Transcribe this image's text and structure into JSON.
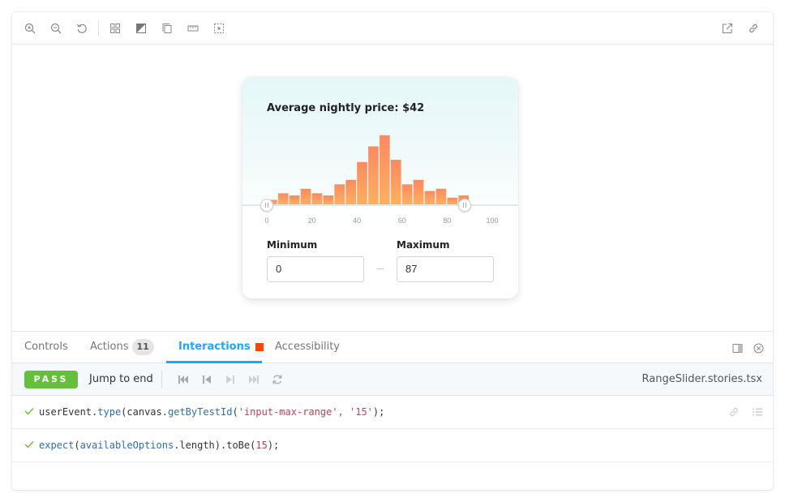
{
  "toolbar": {
    "left_icons": [
      "zoom-in-icon",
      "zoom-out-icon",
      "reset-zoom-icon",
      "grid-icon",
      "background-icon",
      "viewport-icon",
      "measure-icon",
      "outline-icon"
    ],
    "right_icons": [
      "open-new-tab-icon",
      "copy-link-icon"
    ]
  },
  "card": {
    "title": "Average nightly price: $42",
    "chart_data": {
      "type": "bar",
      "x": [
        0,
        5,
        10,
        15,
        20,
        25,
        30,
        35,
        40,
        45,
        50,
        55,
        60,
        65,
        70,
        75,
        80,
        85,
        90,
        95
      ],
      "values": [
        2,
        5,
        4,
        7,
        5,
        4,
        9,
        11,
        19,
        26,
        31,
        20,
        9,
        11,
        6,
        7
      ],
      "all_values": [
        2,
        5,
        4,
        7,
        5,
        4,
        9,
        11,
        19,
        26,
        31,
        20,
        9,
        11,
        6,
        7
      ],
      "ticks": [
        "0",
        "20",
        "40",
        "60",
        "80",
        "100"
      ],
      "selected_range": [
        0,
        87
      ],
      "colors": {
        "bar_top": "#fb8a63",
        "bar_bottom": "#ffb05e",
        "inactive": "#e2e2e2"
      }
    },
    "minimum_label": "Minimum",
    "maximum_label": "Maximum",
    "minimum_value": "0",
    "maximum_value": "87"
  },
  "tabs": {
    "controls": "Controls",
    "actions": "Actions",
    "actions_count": "11",
    "interactions": "Interactions",
    "accessibility": "Accessibility"
  },
  "interactions": {
    "status": "PASS",
    "jump_label": "Jump to end",
    "filename": "RangeSlider.stories.tsx",
    "rows": [
      {
        "parts": [
          "userEvent",
          ".",
          "type",
          "(",
          "canvas",
          ".",
          "getByTestId",
          "(",
          "'input-max-range'",
          ", ",
          "'15'",
          ");"
        ]
      },
      {
        "parts": [
          "expect",
          "(",
          "availableOptions",
          ".",
          "length",
          ").",
          "toBe",
          "(",
          "15",
          ");"
        ]
      }
    ]
  },
  "colors": {
    "accent": "#1ea7fd",
    "pass": "#66bf3c",
    "status": "#ff4400"
  }
}
